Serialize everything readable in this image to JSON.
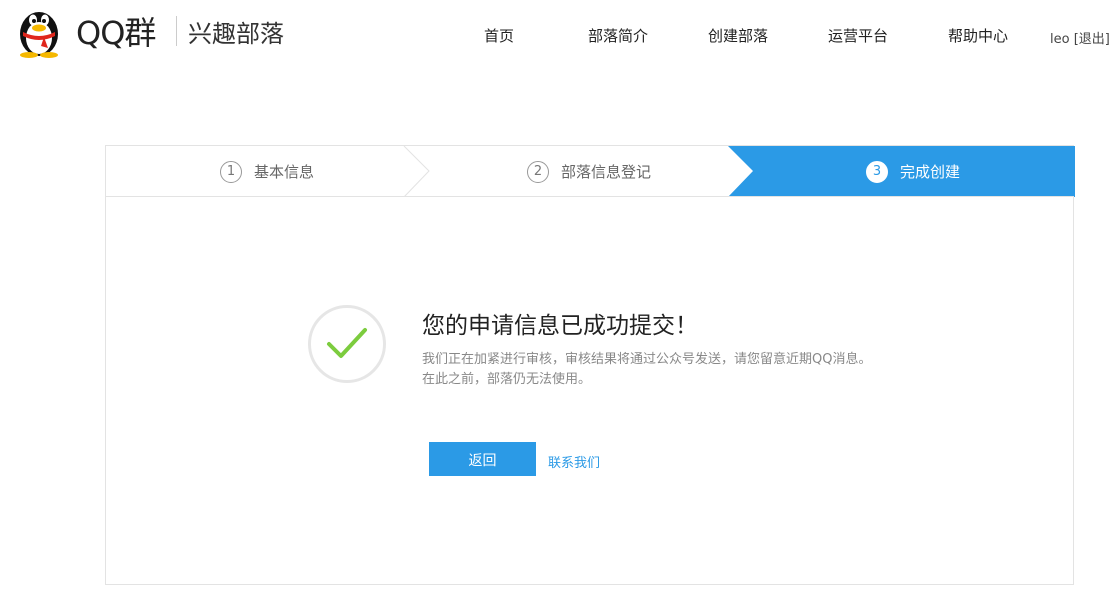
{
  "header": {
    "logo_text": "QQ群",
    "logo_subtitle": "兴趣部落",
    "nav": [
      {
        "label": "首页"
      },
      {
        "label": "部落简介"
      },
      {
        "label": "创建部落"
      },
      {
        "label": "运营平台"
      },
      {
        "label": "帮助中心"
      }
    ],
    "user": {
      "name": "leo",
      "logout": "[退出]"
    }
  },
  "steps": [
    {
      "number": "1",
      "label": "基本信息",
      "active": false
    },
    {
      "number": "2",
      "label": "部落信息登记",
      "active": false
    },
    {
      "number": "3",
      "label": "完成创建",
      "active": true
    }
  ],
  "result": {
    "title": "您的申请信息已成功提交！",
    "desc_line1": "我们正在加紧进行审核，审核结果将通过公众号发送，请您留意近期QQ消息。",
    "desc_line2": "在此之前，部落仍无法使用。",
    "back_button": "返回",
    "contact_link": "联系我们"
  },
  "colors": {
    "accent": "#2b9ae6",
    "check": "#7ccc3e",
    "border": "#e3e3e3"
  }
}
